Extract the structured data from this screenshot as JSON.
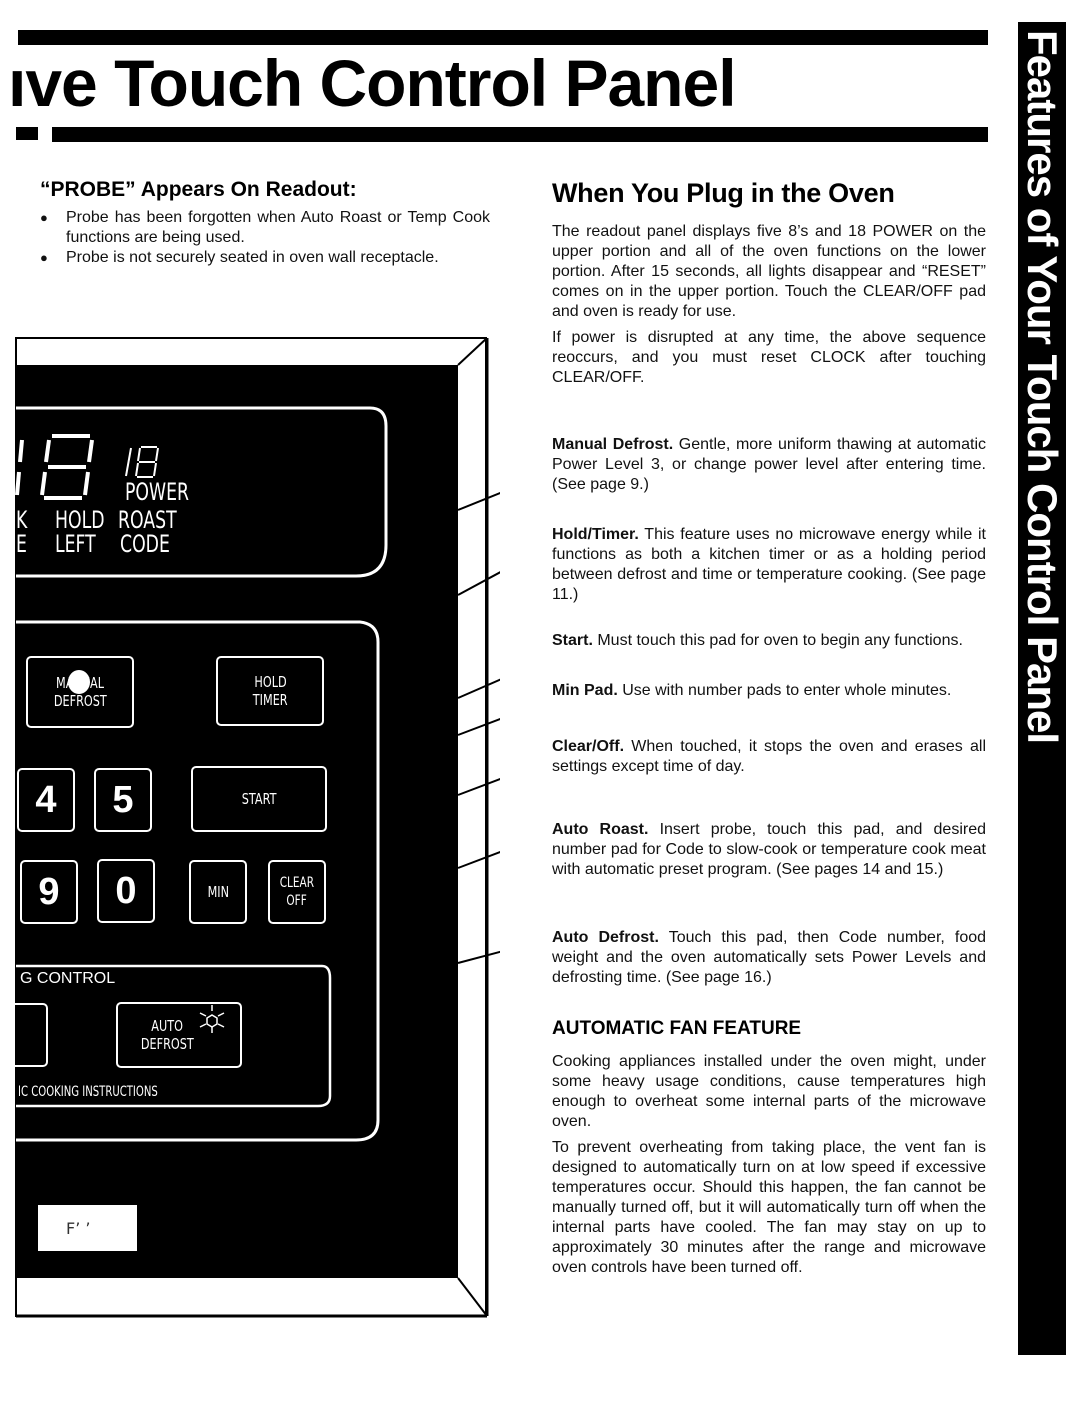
{
  "header": {
    "title": "ıve Touch Control Panel"
  },
  "side_tab": {
    "text": "Features of Your Touch Control Panel"
  },
  "probe_section": {
    "heading": "“PROBE” Appears On Readout:",
    "bullets": [
      "Probe has been forgotten when Auto Roast or Temp Cook functions are being used.",
      "Probe is not securely seated in oven wall receptacle."
    ]
  },
  "plug_section": {
    "heading": "When You Plug in the Oven",
    "paragraphs": [
      "The readout panel displays five 8’s and 18 POWER on the upper portion and all of the oven functions on the lower portion. After 15 seconds, all lights disappear and “RESET” comes on in the upper portion. Touch the CLEAR/OFF pad and oven is ready for use.",
      "If power is disrupted at any time, the above sequence reoccurs, and you must reset CLOCK after touching CLEAR/OFF."
    ]
  },
  "features": [
    {
      "name": "Manual Defrost.",
      "text": " Gentle, more uniform thawing at automatic Power Level 3, or change power level after entering time. (See page 9.)"
    },
    {
      "name": "Hold/Timer.",
      "text": " This feature uses no microwave energy while it functions as both a kitchen timer or as a holding period between defrost and time or temperature cooking. (See page 11.)"
    },
    {
      "name": "Start.",
      "text": " Must touch this pad for oven to begin any functions."
    },
    {
      "name": "Min Pad.",
      "text": " Use with number pads to enter whole minutes."
    },
    {
      "name": "Clear/Off.",
      "text": " When touched, it stops the oven and erases all settings except time of day."
    },
    {
      "name": "Auto Roast.",
      "text": " Insert probe, touch this pad, and desired number pad for Code to slow-cook or temperature cook meat with automatic preset program. (See pages 14 and 15.)"
    },
    {
      "name": "Auto Defrost.",
      "text": " Touch this pad, then Code number, food weight and the oven automatically sets Power Levels and defrosting time. (See page 16.)"
    }
  ],
  "fan_section": {
    "heading": "AUTOMATIC FAN FEATURE",
    "paragraphs": [
      "Cooking appliances installed under the oven might, under some heavy usage conditions, cause temperatures high enough to overheat some internal parts of the microwave oven.",
      "To prevent overheating from taking place, the vent fan is designed to automatically turn on at low speed if excessive temperatures occur. Should this happen, the fan cannot be manually turned off, but it will automatically turn off when the internal parts have cooled. The fan may stay on up to approximately 30 minutes after the range and microwave oven controls have been turned off."
    ]
  },
  "panel": {
    "display": {
      "power_digits": "18",
      "power_label": "POWER",
      "labels_row1": [
        "K",
        "HOLD",
        "ROAST"
      ],
      "labels_row2": [
        "E",
        "LEFT",
        "CODE"
      ]
    },
    "keys": {
      "manual_defrost": [
        "MANUAL",
        "DEFROST"
      ],
      "hold_timer": [
        "HOLD",
        "TIMER"
      ],
      "num_4": "4",
      "num_5": "5",
      "start": "START",
      "num_9": "9",
      "num_0": "0",
      "min": "MIN",
      "clear_off": [
        "CLEAR",
        "OFF"
      ],
      "auto_defrost": [
        "AUTO",
        "DEFROST"
      ]
    },
    "section_label": "G CONTROL",
    "instructions_label": "IC COOKING INSTRUCTIONS",
    "model_label": "F’ ’"
  }
}
